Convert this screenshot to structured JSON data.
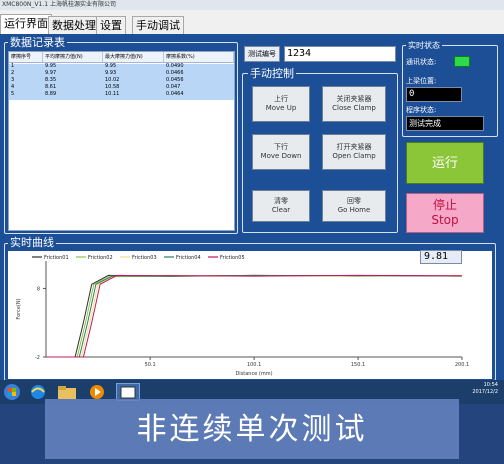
{
  "window": {
    "title": "XMC800N_V1.1 上海帆桂源实业有限公司"
  },
  "tabs": [
    {
      "label": "运行界面",
      "active": true
    },
    {
      "label": "数据处理",
      "active": false
    },
    {
      "label": "设置",
      "active": false
    },
    {
      "label": "手动调试",
      "active": false
    }
  ],
  "records": {
    "title": "数据记录表",
    "columns": [
      "摩擦序号",
      "平均摩擦力值(N)",
      "最大摩擦力值(N)",
      "摩擦系数(%)"
    ],
    "rows": [
      [
        "1",
        "9.95",
        "9.95",
        "0.0490"
      ],
      [
        "2",
        "9.97",
        "9.93",
        "0.0466"
      ],
      [
        "3",
        "8.35",
        "10.02",
        "0.0456"
      ],
      [
        "4",
        "8.61",
        "10.58",
        "0.047"
      ],
      [
        "5",
        "8.89",
        "10.11",
        "0.0464"
      ]
    ]
  },
  "test_id": {
    "button": "测试编号",
    "value": "1234"
  },
  "manual": {
    "title": "手动控制",
    "buttons": {
      "up": {
        "cn": "上行",
        "en": "Move Up"
      },
      "close_clamp": {
        "cn": "关闭夹紧器",
        "en": "Close Clamp"
      },
      "down": {
        "cn": "下行",
        "en": "Move Down"
      },
      "open_clamp": {
        "cn": "打开夹紧器",
        "en": "Open Clamp"
      },
      "clear": {
        "cn": "清零",
        "en": "Clear"
      },
      "home": {
        "cn": "回零",
        "en": "Go Home"
      }
    }
  },
  "status": {
    "title": "实时状态",
    "comm_label": "通讯状态:",
    "position_label": "上梁位置:",
    "position_value": "0",
    "program_label": "程序状态:",
    "program_value": "测试完成",
    "comm_color": "#2ed94a"
  },
  "run_button": {
    "label": "运行",
    "color": "#8ac638"
  },
  "stop_button": {
    "line1": "停止",
    "line2": "Stop",
    "color": "#f6a8c8"
  },
  "curve": {
    "title": "实时曲线",
    "readout": "9.81"
  },
  "chart_data": {
    "type": "line",
    "xlabel": "Distance (mm)",
    "ylabel": "Force(N)",
    "xlim": [
      0,
      200.1
    ],
    "ylim": [
      -2,
      12
    ],
    "x_ticks": [
      "50.1",
      "100.1",
      "150.1",
      "200.1"
    ],
    "y_ticks": [
      "8",
      "-2"
    ],
    "series": [
      {
        "name": "Friction01",
        "color": "#2b2b2b",
        "points": [
          [
            0,
            -2
          ],
          [
            14,
            -2
          ],
          [
            18,
            3
          ],
          [
            22,
            8.6
          ],
          [
            30,
            9.9
          ],
          [
            60,
            9.8
          ],
          [
            100,
            9.9
          ],
          [
            150,
            9.8
          ],
          [
            200,
            9.85
          ]
        ]
      },
      {
        "name": "Friction02",
        "color": "#8bc34a",
        "points": [
          [
            0,
            -2
          ],
          [
            15,
            -2
          ],
          [
            19,
            3
          ],
          [
            23,
            8.6
          ],
          [
            31,
            9.8
          ],
          [
            60,
            9.9
          ],
          [
            100,
            9.8
          ],
          [
            150,
            9.9
          ],
          [
            200,
            9.8
          ]
        ]
      },
      {
        "name": "Friction03",
        "color": "#f0e08a",
        "points": [
          [
            0,
            -2
          ],
          [
            17,
            -2
          ],
          [
            21,
            3
          ],
          [
            25,
            8.6
          ],
          [
            33,
            9.7
          ],
          [
            60,
            9.8
          ],
          [
            100,
            9.85
          ],
          [
            150,
            9.8
          ],
          [
            200,
            9.9
          ]
        ]
      },
      {
        "name": "Friction04",
        "color": "#2e7d5b",
        "points": [
          [
            0,
            -2
          ],
          [
            16,
            -2
          ],
          [
            20,
            3
          ],
          [
            24,
            8.6
          ],
          [
            32,
            9.8
          ],
          [
            60,
            9.75
          ],
          [
            100,
            9.9
          ],
          [
            150,
            9.85
          ],
          [
            200,
            9.8
          ]
        ]
      },
      {
        "name": "Friction05",
        "color": "#c2185b",
        "points": [
          [
            0,
            -2
          ],
          [
            18,
            -2
          ],
          [
            22,
            3
          ],
          [
            26,
            8.6
          ],
          [
            34,
            9.9
          ],
          [
            60,
            9.85
          ],
          [
            100,
            9.8
          ],
          [
            150,
            9.9
          ],
          [
            200,
            9.85
          ]
        ]
      }
    ]
  },
  "taskbar": {
    "time": "10:54",
    "date": "2017/12/2"
  },
  "caption": {
    "text": "非连续单次测试"
  }
}
